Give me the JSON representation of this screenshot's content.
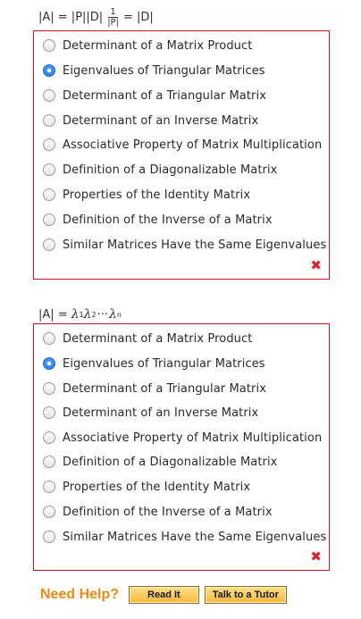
{
  "q1": {
    "equation": {
      "lhs": "|A| = |P||D|",
      "frac_num": "1",
      "frac_den": "|P|",
      "rhs": "= |D|"
    },
    "options": [
      "Determinant of a Matrix Product",
      "Eigenvalues of Triangular Matrices",
      "Determinant of a Triangular Matrix",
      "Determinant of an Inverse Matrix",
      "Associative Property of Matrix Multiplication",
      "Definition of a Diagonalizable Matrix",
      "Properties of the Identity Matrix",
      "Definition of the Inverse of a Matrix",
      "Similar Matrices Have the Same Eigenvalues"
    ],
    "selected_index": 1,
    "result_mark": "✖"
  },
  "q2": {
    "equation": {
      "lhs": "|A| = ",
      "l1": "λ",
      "s1": "1",
      "l2": "λ",
      "s2": "2",
      "dots": "···",
      "ln": "λ",
      "sn": "n"
    },
    "options": [
      "Determinant of a Matrix Product",
      "Eigenvalues of Triangular Matrices",
      "Determinant of a Triangular Matrix",
      "Determinant of an Inverse Matrix",
      "Associative Property of Matrix Multiplication",
      "Definition of a Diagonalizable Matrix",
      "Properties of the Identity Matrix",
      "Definition of the Inverse of a Matrix",
      "Similar Matrices Have the Same Eigenvalues"
    ],
    "selected_index": 1,
    "result_mark": "✖"
  },
  "help": {
    "label": "Need Help?",
    "read_it": "Read It",
    "talk_to_tutor": "Talk to a Tutor"
  }
}
